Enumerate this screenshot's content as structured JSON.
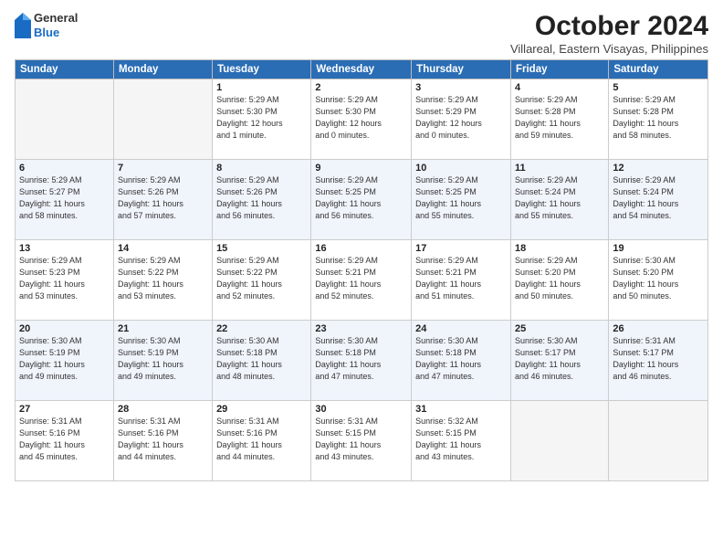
{
  "logo": {
    "general": "General",
    "blue": "Blue"
  },
  "title": "October 2024",
  "location": "Villareal, Eastern Visayas, Philippines",
  "weekdays": [
    "Sunday",
    "Monday",
    "Tuesday",
    "Wednesday",
    "Thursday",
    "Friday",
    "Saturday"
  ],
  "weeks": [
    [
      {
        "day": "",
        "info": ""
      },
      {
        "day": "",
        "info": ""
      },
      {
        "day": "1",
        "info": "Sunrise: 5:29 AM\nSunset: 5:30 PM\nDaylight: 12 hours\nand 1 minute."
      },
      {
        "day": "2",
        "info": "Sunrise: 5:29 AM\nSunset: 5:30 PM\nDaylight: 12 hours\nand 0 minutes."
      },
      {
        "day": "3",
        "info": "Sunrise: 5:29 AM\nSunset: 5:29 PM\nDaylight: 12 hours\nand 0 minutes."
      },
      {
        "day": "4",
        "info": "Sunrise: 5:29 AM\nSunset: 5:28 PM\nDaylight: 11 hours\nand 59 minutes."
      },
      {
        "day": "5",
        "info": "Sunrise: 5:29 AM\nSunset: 5:28 PM\nDaylight: 11 hours\nand 58 minutes."
      }
    ],
    [
      {
        "day": "6",
        "info": "Sunrise: 5:29 AM\nSunset: 5:27 PM\nDaylight: 11 hours\nand 58 minutes."
      },
      {
        "day": "7",
        "info": "Sunrise: 5:29 AM\nSunset: 5:26 PM\nDaylight: 11 hours\nand 57 minutes."
      },
      {
        "day": "8",
        "info": "Sunrise: 5:29 AM\nSunset: 5:26 PM\nDaylight: 11 hours\nand 56 minutes."
      },
      {
        "day": "9",
        "info": "Sunrise: 5:29 AM\nSunset: 5:25 PM\nDaylight: 11 hours\nand 56 minutes."
      },
      {
        "day": "10",
        "info": "Sunrise: 5:29 AM\nSunset: 5:25 PM\nDaylight: 11 hours\nand 55 minutes."
      },
      {
        "day": "11",
        "info": "Sunrise: 5:29 AM\nSunset: 5:24 PM\nDaylight: 11 hours\nand 55 minutes."
      },
      {
        "day": "12",
        "info": "Sunrise: 5:29 AM\nSunset: 5:24 PM\nDaylight: 11 hours\nand 54 minutes."
      }
    ],
    [
      {
        "day": "13",
        "info": "Sunrise: 5:29 AM\nSunset: 5:23 PM\nDaylight: 11 hours\nand 53 minutes."
      },
      {
        "day": "14",
        "info": "Sunrise: 5:29 AM\nSunset: 5:22 PM\nDaylight: 11 hours\nand 53 minutes."
      },
      {
        "day": "15",
        "info": "Sunrise: 5:29 AM\nSunset: 5:22 PM\nDaylight: 11 hours\nand 52 minutes."
      },
      {
        "day": "16",
        "info": "Sunrise: 5:29 AM\nSunset: 5:21 PM\nDaylight: 11 hours\nand 52 minutes."
      },
      {
        "day": "17",
        "info": "Sunrise: 5:29 AM\nSunset: 5:21 PM\nDaylight: 11 hours\nand 51 minutes."
      },
      {
        "day": "18",
        "info": "Sunrise: 5:29 AM\nSunset: 5:20 PM\nDaylight: 11 hours\nand 50 minutes."
      },
      {
        "day": "19",
        "info": "Sunrise: 5:30 AM\nSunset: 5:20 PM\nDaylight: 11 hours\nand 50 minutes."
      }
    ],
    [
      {
        "day": "20",
        "info": "Sunrise: 5:30 AM\nSunset: 5:19 PM\nDaylight: 11 hours\nand 49 minutes."
      },
      {
        "day": "21",
        "info": "Sunrise: 5:30 AM\nSunset: 5:19 PM\nDaylight: 11 hours\nand 49 minutes."
      },
      {
        "day": "22",
        "info": "Sunrise: 5:30 AM\nSunset: 5:18 PM\nDaylight: 11 hours\nand 48 minutes."
      },
      {
        "day": "23",
        "info": "Sunrise: 5:30 AM\nSunset: 5:18 PM\nDaylight: 11 hours\nand 47 minutes."
      },
      {
        "day": "24",
        "info": "Sunrise: 5:30 AM\nSunset: 5:18 PM\nDaylight: 11 hours\nand 47 minutes."
      },
      {
        "day": "25",
        "info": "Sunrise: 5:30 AM\nSunset: 5:17 PM\nDaylight: 11 hours\nand 46 minutes."
      },
      {
        "day": "26",
        "info": "Sunrise: 5:31 AM\nSunset: 5:17 PM\nDaylight: 11 hours\nand 46 minutes."
      }
    ],
    [
      {
        "day": "27",
        "info": "Sunrise: 5:31 AM\nSunset: 5:16 PM\nDaylight: 11 hours\nand 45 minutes."
      },
      {
        "day": "28",
        "info": "Sunrise: 5:31 AM\nSunset: 5:16 PM\nDaylight: 11 hours\nand 44 minutes."
      },
      {
        "day": "29",
        "info": "Sunrise: 5:31 AM\nSunset: 5:16 PM\nDaylight: 11 hours\nand 44 minutes."
      },
      {
        "day": "30",
        "info": "Sunrise: 5:31 AM\nSunset: 5:15 PM\nDaylight: 11 hours\nand 43 minutes."
      },
      {
        "day": "31",
        "info": "Sunrise: 5:32 AM\nSunset: 5:15 PM\nDaylight: 11 hours\nand 43 minutes."
      },
      {
        "day": "",
        "info": ""
      },
      {
        "day": "",
        "info": ""
      }
    ]
  ]
}
